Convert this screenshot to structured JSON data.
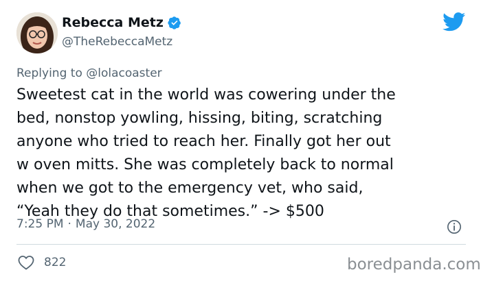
{
  "author": {
    "display_name": "Rebecca Metz",
    "handle": "@TheRebeccaMetz"
  },
  "reply": {
    "replying_to": "Replying to @lolacoaster"
  },
  "tweet": {
    "text": "Sweetest cat in the world was cowering under the\nbed, nonstop yowling, hissing, biting, scratching\nanyone who tried to reach her. Finally got her out\nw oven mitts. She was completely back to normal\nwhen we got to the emergency vet, who said,\n“Yeah they do that sometimes.” -> $500",
    "time": "7:25 PM",
    "separator": "·",
    "date": "May 30, 2022"
  },
  "engagement": {
    "likes": "822"
  },
  "watermark": "boredpanda.com",
  "colors": {
    "twitter_blue": "#1d9bf0",
    "text_primary": "#0f1419",
    "text_secondary": "#536471"
  }
}
